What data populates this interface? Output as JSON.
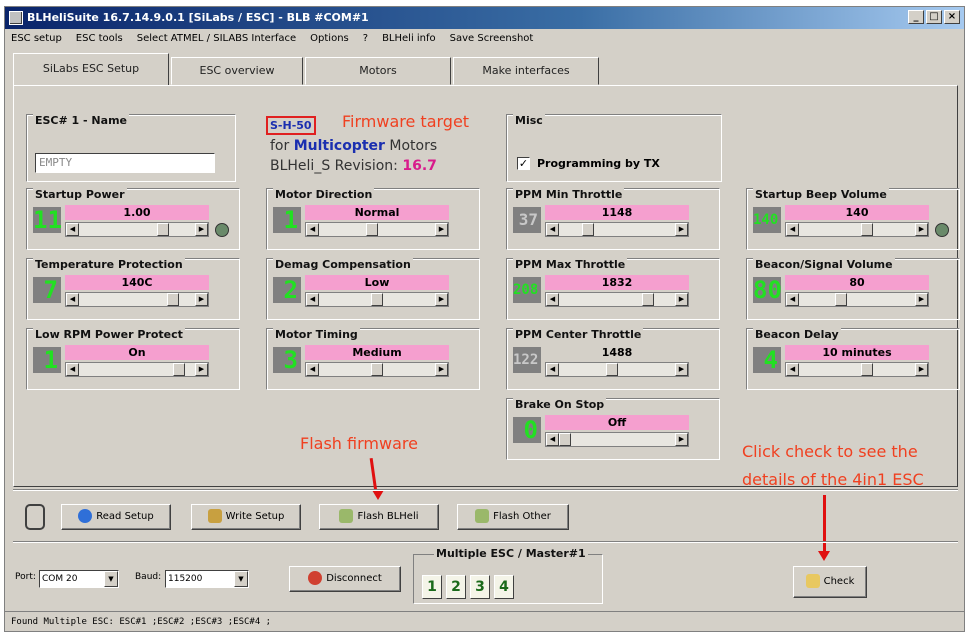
{
  "window": {
    "title": "BLHeliSuite 16.7.14.9.0.1  [SiLabs / ESC] - BLB #COM#1"
  },
  "menu": [
    "ESC setup",
    "ESC tools",
    "Select ATMEL / SILABS Interface",
    "Options",
    "?",
    "BLHeli info",
    "Save Screenshot"
  ],
  "tabs": [
    "SiLabs ESC Setup",
    "ESC overview",
    "Motors",
    "Make interfaces"
  ],
  "esc_name": {
    "title": "ESC# 1 - Name",
    "value": "EMPTY"
  },
  "firmware": {
    "code": "S-H-50",
    "annotation": "Firmware target",
    "for": "for",
    "mc": "Multicopter",
    "motors": "Motors",
    "rev_label": "BLHeli_S Revision:",
    "rev_value": "16.7"
  },
  "misc": {
    "title": "Misc",
    "programming_label": "Programming by TX",
    "programming_checked": "✓"
  },
  "params": [
    {
      "title": "Startup Power",
      "num": "11",
      "label": "1.00",
      "thumb": 0.75,
      "pink": true,
      "icon": true
    },
    {
      "title": "Motor Direction",
      "num": "1",
      "label": "Normal",
      "thumb": 0.45,
      "pink": true
    },
    {
      "title": "PPM Min Throttle",
      "num": "37",
      "label": "1148",
      "thumb": 0.22,
      "pink": true,
      "dim": true
    },
    {
      "title": "Startup Beep Volume",
      "num": "140",
      "label": "140",
      "thumb": 0.6,
      "pink": true,
      "icon": true
    },
    {
      "title": "Temperature Protection",
      "num": "7",
      "label": "140C",
      "thumb": 0.85,
      "pink": true
    },
    {
      "title": "Demag Compensation",
      "num": "2",
      "label": "Low",
      "thumb": 0.5,
      "pink": true
    },
    {
      "title": "PPM Max Throttle",
      "num": "208",
      "label": "1832",
      "thumb": 0.8,
      "pink": true
    },
    {
      "title": "Beacon/Signal Volume",
      "num": "80",
      "label": "80",
      "thumb": 0.35,
      "pink": true
    },
    {
      "title": "Low RPM Power Protect",
      "num": "1",
      "label": "On",
      "thumb": 0.9,
      "pink": true
    },
    {
      "title": "Motor Timing",
      "num": "3",
      "label": "Medium",
      "thumb": 0.5,
      "pink": true
    },
    {
      "title": "PPM Center Throttle",
      "num": "122",
      "label": "1488",
      "thumb": 0.45,
      "pink": false,
      "dim": true
    },
    {
      "title": "Beacon Delay",
      "num": "4",
      "label": "10 minutes",
      "thumb": 0.6,
      "pink": true
    },
    {
      "title": "Brake On Stop",
      "num": "0",
      "label": "Off",
      "thumb": 0.0,
      "pink": true
    }
  ],
  "annotations": {
    "flash": "Flash firmware",
    "check_line1": "Click check to see the",
    "check_line2": "details of the 4in1 ESC"
  },
  "buttons": {
    "read_setup": "Read Setup",
    "write_setup": "Write Setup",
    "flash_blheli": "Flash BLHeli",
    "flash_other": "Flash Other",
    "disconnect": "Disconnect",
    "check": "Check"
  },
  "connection": {
    "port_label": "Port:",
    "port_value": "COM 20",
    "baud_label": "Baud:",
    "baud_value": "115200",
    "multi_title": "Multiple ESC / Master#1",
    "esc_numbers": [
      "1",
      "2",
      "3",
      "4"
    ]
  },
  "status": "Found Multiple ESC: ESC#1 ;ESC#2 ;ESC#3 ;ESC#4 ;",
  "colors": {
    "pink": "#f59fcf",
    "digit_green": "#22e022",
    "annotation": "#f04020",
    "arrow": "#e01010"
  }
}
